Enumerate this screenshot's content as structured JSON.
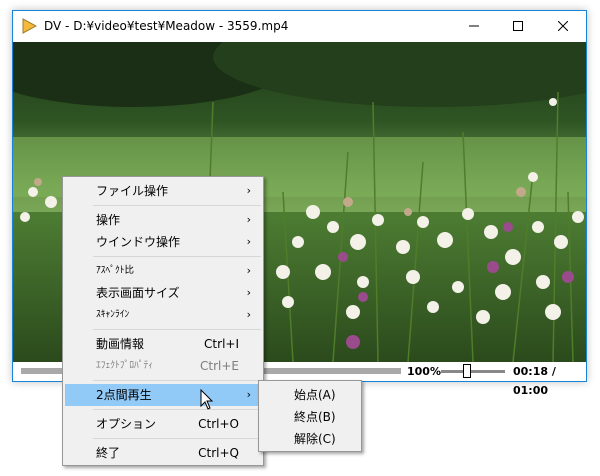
{
  "window": {
    "title": "DV - D:¥video¥test¥Meadow - 3559.mp4"
  },
  "controls": {
    "zoom": "100%",
    "time": "00:18 / 01:00",
    "volume_level": 0.45,
    "progress": 0.3
  },
  "context_menu": {
    "items": [
      {
        "label": "ファイル操作",
        "arrow": "›"
      },
      {
        "label": "操作",
        "arrow": "›"
      },
      {
        "label": "ウインドウ操作",
        "arrow": "›"
      },
      {
        "label": "ｱｽﾍﾟｸﾄ比",
        "arrow": "›"
      },
      {
        "label": "表示画面サイズ",
        "arrow": "›"
      },
      {
        "label": "ｽｷｬﾝﾗｲﾝ",
        "arrow": "›"
      },
      {
        "label": "動画情報",
        "shortcut": "Ctrl+I"
      },
      {
        "label": "ｴﾌｪｸﾄﾌﾟﾛﾊﾟﾃｨ",
        "shortcut": "Ctrl+E"
      },
      {
        "label": "2点間再生",
        "arrow": "›"
      },
      {
        "label": "オプション",
        "shortcut": "Ctrl+O"
      },
      {
        "label": "終了",
        "shortcut": "Ctrl+Q"
      }
    ]
  },
  "submenu": {
    "items": [
      {
        "label": "始点(A)"
      },
      {
        "label": "終点(B)"
      },
      {
        "label": "解除(C)"
      }
    ]
  },
  "colors": {
    "titlebar_border": "#1883d7",
    "menu_highlight": "#91c9f7",
    "menu_bg": "#f0f0f0"
  }
}
